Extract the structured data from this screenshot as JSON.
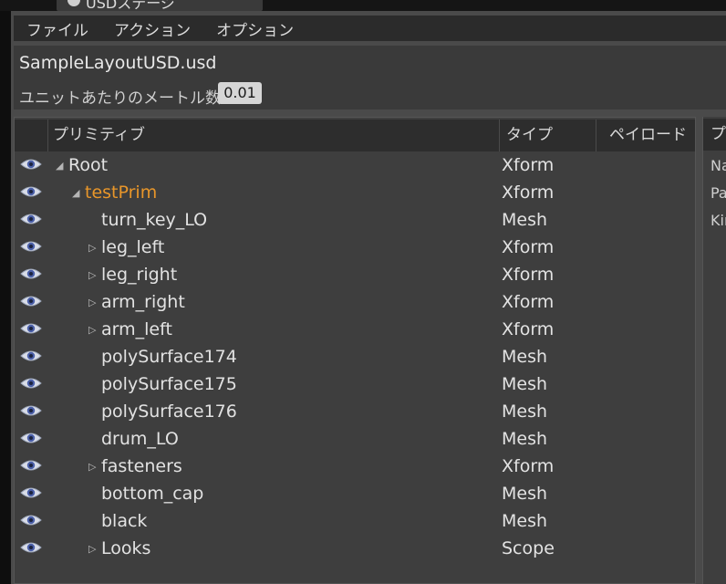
{
  "window": {
    "title": "USDステージ"
  },
  "menu": {
    "items": [
      "ファイル",
      "アクション",
      "オプション"
    ]
  },
  "info": {
    "filename": "SampleLayoutUSD.usd",
    "scale_label": "ユニットあたりのメートル数",
    "scale_value": "0.01"
  },
  "tree": {
    "columns": {
      "primitive": "プリミティブ",
      "type": "タイプ",
      "payload": "ペイロード"
    },
    "rows": [
      {
        "name": "Root",
        "type": "Xform",
        "depth": 0,
        "expander": "expanded",
        "highlight": false
      },
      {
        "name": "testPrim",
        "type": "Xform",
        "depth": 1,
        "expander": "expanded",
        "highlight": true
      },
      {
        "name": "turn_key_LO",
        "type": "Mesh",
        "depth": 2,
        "expander": "none",
        "highlight": false
      },
      {
        "name": "leg_left",
        "type": "Xform",
        "depth": 2,
        "expander": "collapsed",
        "highlight": false
      },
      {
        "name": "leg_right",
        "type": "Xform",
        "depth": 2,
        "expander": "collapsed",
        "highlight": false
      },
      {
        "name": "arm_right",
        "type": "Xform",
        "depth": 2,
        "expander": "collapsed",
        "highlight": false
      },
      {
        "name": "arm_left",
        "type": "Xform",
        "depth": 2,
        "expander": "collapsed",
        "highlight": false
      },
      {
        "name": "polySurface174",
        "type": "Mesh",
        "depth": 2,
        "expander": "none",
        "highlight": false
      },
      {
        "name": "polySurface175",
        "type": "Mesh",
        "depth": 2,
        "expander": "none",
        "highlight": false
      },
      {
        "name": "polySurface176",
        "type": "Mesh",
        "depth": 2,
        "expander": "none",
        "highlight": false
      },
      {
        "name": "drum_LO",
        "type": "Mesh",
        "depth": 2,
        "expander": "none",
        "highlight": false
      },
      {
        "name": "fasteners",
        "type": "Xform",
        "depth": 2,
        "expander": "collapsed",
        "highlight": false
      },
      {
        "name": "bottom_cap",
        "type": "Mesh",
        "depth": 2,
        "expander": "none",
        "highlight": false
      },
      {
        "name": "black",
        "type": "Mesh",
        "depth": 2,
        "expander": "none",
        "highlight": false
      },
      {
        "name": "Looks",
        "type": "Scope",
        "depth": 2,
        "expander": "collapsed",
        "highlight": false
      }
    ]
  },
  "details": {
    "header": "プ",
    "labels": [
      "Na",
      "Pa",
      "Kir"
    ]
  },
  "icons": {
    "visibility": "eye-icon",
    "expanded": "triangle-down-icon",
    "collapsed": "triangle-right-icon"
  },
  "colors": {
    "highlight": "#e8962a"
  }
}
